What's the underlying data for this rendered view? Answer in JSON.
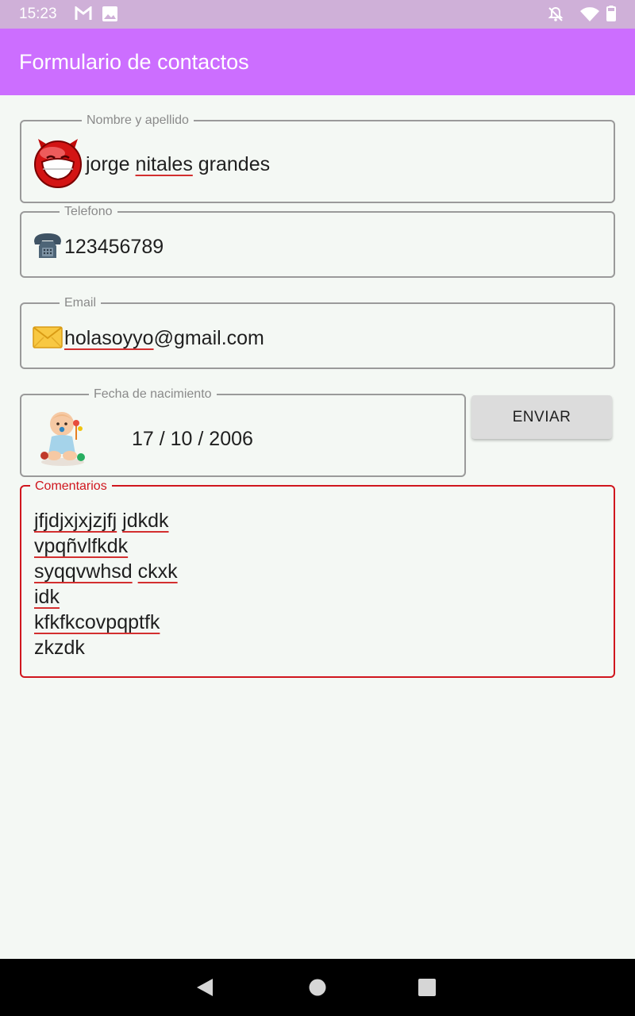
{
  "status_bar": {
    "time": "15:23",
    "icons": [
      "gmail-icon",
      "image-icon",
      "notifications-off-icon",
      "wifi-icon",
      "battery-icon"
    ]
  },
  "app_bar": {
    "title": "Formulario de contactos",
    "color": "#cc6eff"
  },
  "form": {
    "name": {
      "label": "Nombre y apellido",
      "value_words": [
        "jorge ",
        "nitales",
        " grandes"
      ],
      "icon": "devil-smiley-icon"
    },
    "phone": {
      "label": "Telefono",
      "value": "123456789",
      "icon": "telephone-icon"
    },
    "email": {
      "label": "Email",
      "value_parts": [
        "holasoyyo",
        "@gmail.com"
      ],
      "icon": "envelope-icon"
    },
    "birth_date": {
      "label": "Fecha de nacimiento",
      "value": "17 / 10 / 2006",
      "icon": "baby-icon"
    },
    "send_button": {
      "label": "ENVIAR"
    },
    "comments": {
      "label": "Comentarios",
      "lines": [
        [
          {
            "t": "jfjdjxjxjzjfj",
            "u": true
          },
          {
            "t": " ",
            "u": false
          },
          {
            "t": "jdkdk",
            "u": true
          }
        ],
        [
          {
            "t": "vpqñvlfkdk",
            "u": true
          }
        ],
        [
          {
            "t": "syqqvwhsd",
            "u": true
          },
          {
            "t": " ",
            "u": false
          },
          {
            "t": "ckxk",
            "u": true
          }
        ],
        [
          {
            "t": "idk",
            "u": true
          }
        ],
        [
          {
            "t": "kfkfkcovpqptfk",
            "u": true
          }
        ],
        [
          {
            "t": "zkzdk",
            "u": false
          }
        ]
      ],
      "error_color": "#d0161e"
    }
  },
  "nav_bar": {
    "buttons": [
      "back-icon",
      "home-icon",
      "recents-icon"
    ]
  }
}
